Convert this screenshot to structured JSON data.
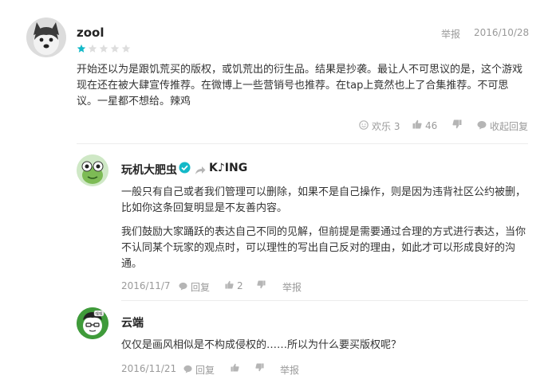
{
  "main_review": {
    "username": "zool",
    "rating": 1,
    "rating_max": 5,
    "report_label": "举报",
    "date": "2016/10/28",
    "text": "开始还以为是跟饥荒买的版权，或饥荒出的衍生品。结果是抄袭。最让人不可思议的是，这个游戏现在还在被大肆宣传推荐。在微博上一些营销号也推荐。在tap上竟然也上了合集推荐。不可思议。一星都不想给。辣鸡",
    "funny_label": "欢乐 3",
    "like_count": "46",
    "collapse_label": "收起回复"
  },
  "replies": [
    {
      "username": "玩机大肥虫",
      "reply_to": "K♪ING",
      "paragraphs": [
        "一般只有自己或者我们管理可以删除，如果不是自己操作，则是因为违背社区公约被删，比如你这条回复明显是不友善内容。",
        "我们鼓励大家踊跃的表达自己不同的见解，但前提是需要通过合理的方式进行表达，当你不认同某个玩家的观点时，可以理性的写出自己反对的理由，如此才可以形成良好的沟通。"
      ],
      "date": "2016/11/7",
      "reply_label": "回复",
      "like_count": "2",
      "report_label": "举报"
    },
    {
      "username": "云端",
      "avatar_badge": "嘿嘿",
      "text": "仅仅是画风相似是不构成侵权的……所以为什么要买版权呢？",
      "date": "2016/11/21",
      "reply_label": "回复",
      "report_label": "举报"
    }
  ],
  "colors": {
    "star_on": "#14b9c8",
    "star_off": "#dddddd",
    "verified": "#14b9c8",
    "icon": "#b5b5b5"
  }
}
